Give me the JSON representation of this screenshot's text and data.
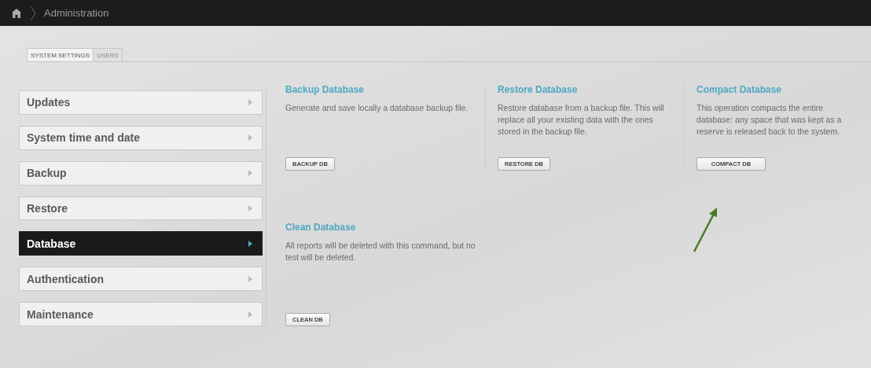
{
  "breadcrumb": {
    "title": "Administration"
  },
  "tabs": [
    {
      "label": "SYSTEM SETTINGS",
      "selected": true
    },
    {
      "label": "USERS",
      "selected": false
    }
  ],
  "sidebar": {
    "items": [
      {
        "label": "Updates",
        "selected": false
      },
      {
        "label": "System time and date",
        "selected": false
      },
      {
        "label": "Backup",
        "selected": false
      },
      {
        "label": "Restore",
        "selected": false
      },
      {
        "label": "Database",
        "selected": true
      },
      {
        "label": "Authentication",
        "selected": false
      },
      {
        "label": "Maintenance",
        "selected": false
      }
    ]
  },
  "sections": [
    {
      "title": "Backup Database",
      "description": "Generate and save locally a database backup file.",
      "button": "BACKUP DB"
    },
    {
      "title": "Restore Database",
      "description": "Restore database from a backup file. This will replace all your existing data with the ones stored in the backup file.",
      "button": "RESTORE DB"
    },
    {
      "title": "Compact Database",
      "description": "This operation compacts the entire database: any space that was kept as a reserve is released back to the system.",
      "button": "COMPACT DB"
    },
    {
      "title": "Clean Database",
      "description": "All reports will be deleted with this command, but no test will be deleted.",
      "button": "CLEAN DB"
    }
  ]
}
